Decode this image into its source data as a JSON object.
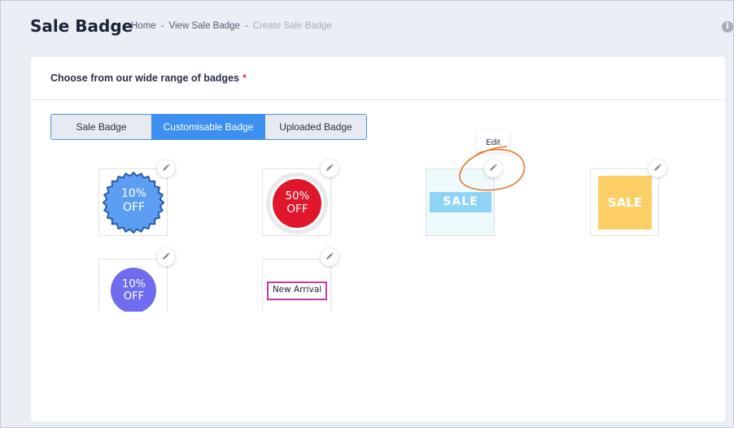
{
  "header": {
    "title": "Sale Badge",
    "breadcrumb": [
      {
        "label": "Home"
      },
      {
        "label": "View Sale Badge"
      },
      {
        "label": "Create Sale Badge"
      }
    ],
    "separator": "-",
    "info_icon_glyph": "i"
  },
  "card": {
    "heading": "Choose from our wide range of badges",
    "required_marker": "*"
  },
  "tabs": [
    {
      "label": "Sale Badge",
      "active": false
    },
    {
      "label": "Customisable Badge",
      "active": true
    },
    {
      "label": "Uploaded Badge",
      "active": false
    }
  ],
  "badges": [
    {
      "name": "10% off starburst",
      "line1": "10%",
      "line2": "OFF",
      "color": "#5b9ef2"
    },
    {
      "name": "50% off circle",
      "line1": "50%",
      "line2": "OFF",
      "color": "#e0172b"
    },
    {
      "name": "Sale ribbon",
      "text": "SALE",
      "color": "#8fd3f7"
    },
    {
      "name": "Sale square",
      "text": "SALE",
      "color": "#fbcf65"
    },
    {
      "name": "10% off circle",
      "line1": "10%",
      "line2": "OFF",
      "color": "#6f6cf0"
    },
    {
      "name": "New arrival tag",
      "text": "New Arrival",
      "color": "#c23aa8"
    }
  ],
  "tooltip": {
    "label": "Edit"
  },
  "colors": {
    "accent": "#3d8ff0",
    "annotation": "#e2772e"
  }
}
